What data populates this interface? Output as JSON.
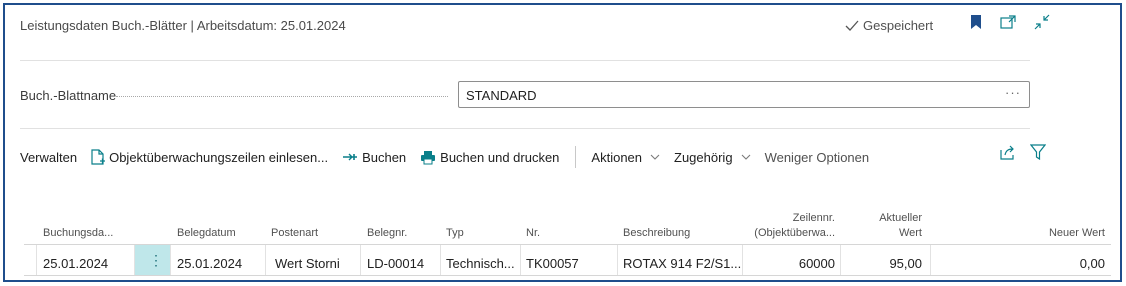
{
  "header": {
    "title": "Leistungsdaten Buch.-Blätter | Arbeitsdatum: 25.01.2024",
    "saved_label": "Gespeichert"
  },
  "field": {
    "label": "Buch.-Blattname",
    "value": "STANDARD",
    "more": "···"
  },
  "actions": {
    "manage": "Verwalten",
    "import": "Objektüberwachungszeilen einlesen...",
    "post": "Buchen",
    "post_print": "Buchen und drucken",
    "actions_menu": "Aktionen",
    "related_menu": "Zugehörig",
    "fewer_options": "Weniger Optionen"
  },
  "table": {
    "columns": {
      "posting_date": "Buchungsda...",
      "doc_date": "Belegdatum",
      "entry_type": "Postenart",
      "doc_no": "Belegnr.",
      "type": "Typ",
      "no": "Nr.",
      "description": "Beschreibung",
      "line_no_1": "Zeilennr.",
      "line_no_2": "(Objektüberwa...",
      "current_value_1": "Aktueller",
      "current_value_2": "Wert",
      "new_value": "Neuer Wert"
    },
    "rows": [
      {
        "posting_date": "25.01.2024",
        "doc_date": "25.01.2024",
        "entry_type": "Wert Storni",
        "doc_no": "LD-00014",
        "type": "Technisch...",
        "no": "TK00057",
        "description": "ROTAX 914 F2/S1...",
        "line_no": "60000",
        "current_value": "95,00",
        "new_value": "0,00"
      }
    ]
  },
  "colors": {
    "frame": "#1f4e8c",
    "accent": "#0a7f8a",
    "selected_cell": "#bfe7ea"
  }
}
